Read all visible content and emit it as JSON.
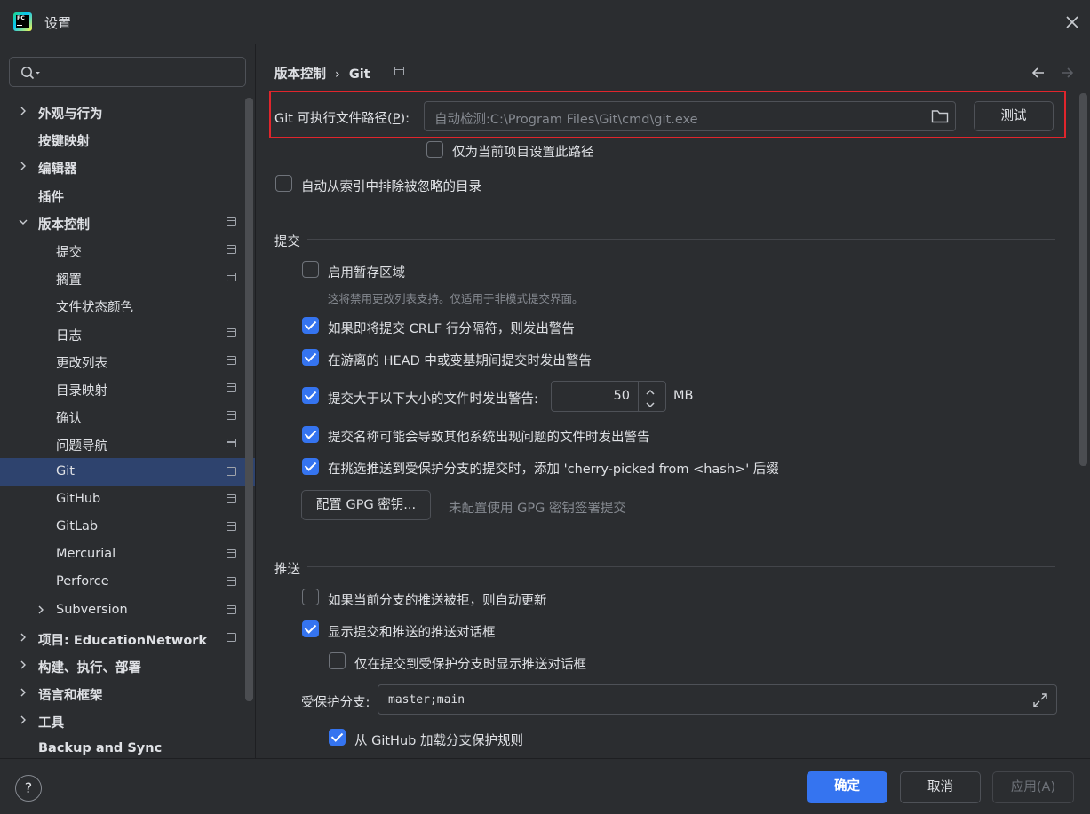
{
  "window": {
    "title": "设置",
    "logo_text": "PC"
  },
  "search": {
    "placeholder": ""
  },
  "sidebar": {
    "items": [
      {
        "label": "外观与行为",
        "bold": true,
        "chevron": "right",
        "indent": 0,
        "pinned": false
      },
      {
        "label": "按键映射",
        "bold": true,
        "chevron": "",
        "indent": 0,
        "pinned": false
      },
      {
        "label": "编辑器",
        "bold": true,
        "chevron": "right",
        "indent": 0,
        "pinned": false
      },
      {
        "label": "插件",
        "bold": true,
        "chevron": "",
        "indent": 0,
        "pinned": false
      },
      {
        "label": "版本控制",
        "bold": true,
        "chevron": "down",
        "indent": 0,
        "pinned": true
      },
      {
        "label": "提交",
        "bold": false,
        "chevron": "",
        "indent": 1,
        "pinned": true
      },
      {
        "label": "搁置",
        "bold": false,
        "chevron": "",
        "indent": 1,
        "pinned": true
      },
      {
        "label": "文件状态颜色",
        "bold": false,
        "chevron": "",
        "indent": 1,
        "pinned": false
      },
      {
        "label": "日志",
        "bold": false,
        "chevron": "",
        "indent": 1,
        "pinned": true
      },
      {
        "label": "更改列表",
        "bold": false,
        "chevron": "",
        "indent": 1,
        "pinned": true
      },
      {
        "label": "目录映射",
        "bold": false,
        "chevron": "",
        "indent": 1,
        "pinned": true
      },
      {
        "label": "确认",
        "bold": false,
        "chevron": "",
        "indent": 1,
        "pinned": true
      },
      {
        "label": "问题导航",
        "bold": false,
        "chevron": "",
        "indent": 1,
        "pinned": true
      },
      {
        "label": "Git",
        "bold": false,
        "chevron": "",
        "indent": 1,
        "pinned": true,
        "selected": true
      },
      {
        "label": "GitHub",
        "bold": false,
        "chevron": "",
        "indent": 1,
        "pinned": true
      },
      {
        "label": "GitLab",
        "bold": false,
        "chevron": "",
        "indent": 1,
        "pinned": true
      },
      {
        "label": "Mercurial",
        "bold": false,
        "chevron": "",
        "indent": 1,
        "pinned": true
      },
      {
        "label": "Perforce",
        "bold": false,
        "chevron": "",
        "indent": 1,
        "pinned": true
      },
      {
        "label": "Subversion",
        "bold": false,
        "chevron": "right",
        "indent": 1,
        "pinned": true
      },
      {
        "label": "项目: EducationNetwork",
        "bold": true,
        "chevron": "right",
        "indent": 0,
        "pinned": true
      },
      {
        "label": "构建、执行、部署",
        "bold": true,
        "chevron": "right",
        "indent": 0,
        "pinned": false
      },
      {
        "label": "语言和框架",
        "bold": true,
        "chevron": "right",
        "indent": 0,
        "pinned": false
      },
      {
        "label": "工具",
        "bold": true,
        "chevron": "right",
        "indent": 0,
        "pinned": false
      },
      {
        "label": "Backup and Sync",
        "bold": true,
        "chevron": "",
        "indent": 0,
        "pinned": false
      }
    ]
  },
  "breadcrumb": {
    "parent": "版本控制",
    "separator": "›",
    "current": "Git"
  },
  "git_path": {
    "label": "Git 可执行文件路径(P):",
    "label_prefix": "Git 可执行文件路径(",
    "label_mnemonic": "P",
    "label_suffix": "):",
    "placeholder": "自动检测:C:\\Program Files\\Git\\cmd\\git.exe",
    "test_button": "测试",
    "project_only_label": "仅为当前项目设置此路径",
    "project_only_checked": false
  },
  "auto_exclude": {
    "label": "自动从索引中排除被忽略的目录",
    "checked": false
  },
  "commit_section": {
    "title": "提交",
    "staging": {
      "label": "启用暂存区域",
      "checked": false,
      "hint": "这将禁用更改列表支持。仅适用于非模式提交界面。"
    },
    "crlf": {
      "label": "如果即将提交 CRLF 行分隔符，则发出警告",
      "checked": true
    },
    "detached_head": {
      "label": "在游离的 HEAD 中或变基期间提交时发出警告",
      "checked": true
    },
    "large_files": {
      "label": "提交大于以下大小的文件时发出警告:",
      "checked": true,
      "value": "50",
      "unit": "MB"
    },
    "bad_names": {
      "label": "提交名称可能会导致其他系统出现问题的文件时发出警告",
      "checked": true
    },
    "cherry_pick": {
      "label": "在挑选推送到受保护分支的提交时，添加 'cherry-picked from <hash>' 后缀",
      "checked": true
    },
    "gpg_button": "配置 GPG 密钥...",
    "gpg_status": "未配置使用 GPG 密钥签署提交"
  },
  "push_section": {
    "title": "推送",
    "auto_update": {
      "label": "如果当前分支的推送被拒，则自动更新",
      "checked": false
    },
    "show_dialog": {
      "label": "显示提交和推送的推送对话框",
      "checked": true
    },
    "protected_only": {
      "label": "仅在提交到受保护分支时显示推送对话框",
      "checked": false
    },
    "protected_label": "受保护分支:",
    "protected_value": "master;main",
    "github_rules": {
      "label": "从 GitHub 加载分支保护规则",
      "checked": true
    }
  },
  "footer": {
    "help": "?",
    "ok": "确定",
    "cancel": "取消",
    "apply": "应用(A)"
  },
  "colors": {
    "accent": "#3574f0",
    "highlight": "#e0252c",
    "background": "#2b2d30",
    "selected_row": "#2e436e"
  }
}
